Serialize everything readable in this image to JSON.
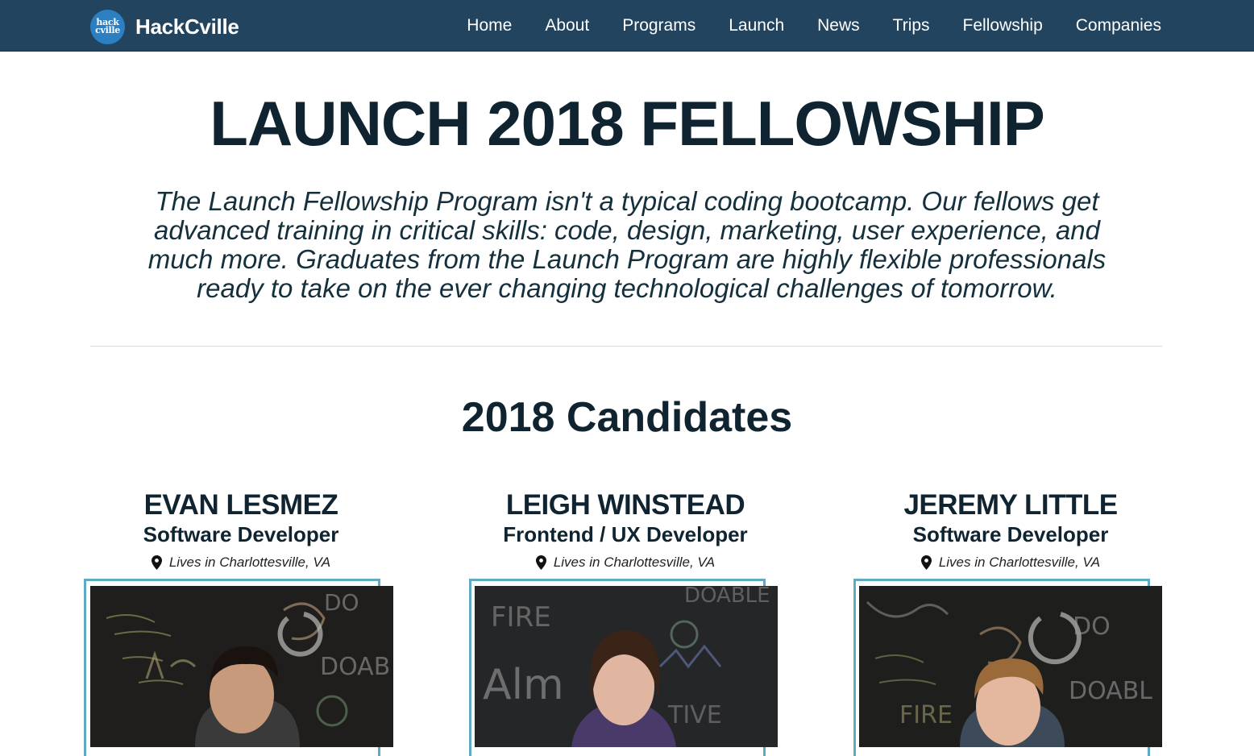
{
  "nav": {
    "logo_line1": "hack",
    "logo_line2": "cville",
    "brand": "HackCville",
    "links": [
      "Home",
      "About",
      "Programs",
      "Launch",
      "News",
      "Trips",
      "Fellowship",
      "Companies"
    ]
  },
  "hero": {
    "title": "LAUNCH 2018 FELLOWSHIP",
    "intro_lines": [
      "The Launch Fellowship Program isn't a typical coding bootcamp. Our fellows get",
      "advanced training in critical skills: code, design, marketing, user experience, and",
      "much more. Graduates from the Launch Program are highly flexible professionals",
      "ready to take on the ever changing technological challenges of tomorrow."
    ]
  },
  "section": {
    "title": "2018 Candidates"
  },
  "candidates": [
    {
      "name": "EVAN LESMEZ",
      "role": "Software Developer",
      "location": "Lives in Charlottesville, VA",
      "photo_icon": "person-photo"
    },
    {
      "name": "LEIGH WINSTEAD",
      "role": "Frontend / UX Developer",
      "location": "Lives in Charlottesville, VA",
      "photo_icon": "person-photo"
    },
    {
      "name": "JEREMY LITTLE",
      "role": "Software Developer",
      "location": "Lives in Charlottesville, VA",
      "photo_icon": "person-photo"
    }
  ],
  "colors": {
    "navbar": "#22445f",
    "text": "#0f2430",
    "frame": "#5fa9c2",
    "logo": "#2d7fc1"
  }
}
